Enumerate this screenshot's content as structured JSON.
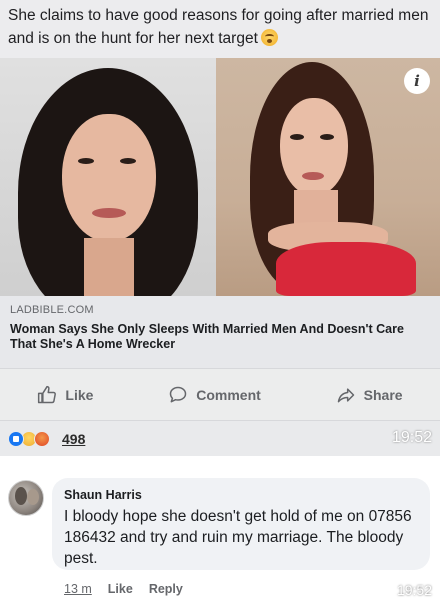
{
  "post": {
    "caption": "She claims to have good reasons for going after married men and is on the hunt for her next target",
    "caption_emoji": "flushed-face-emoji"
  },
  "link_card": {
    "info_icon": "i",
    "source": "LADBIBLE.COM",
    "title": "Woman Says She Only Sleeps With Married Men And Doesn't Care That She's A Home Wrecker"
  },
  "actions": {
    "like_label": "Like",
    "comment_label": "Comment",
    "share_label": "Share"
  },
  "reactions": {
    "icons": [
      "like-reaction-icon",
      "haha-reaction-icon",
      "angry-reaction-icon"
    ],
    "count": "498",
    "time": "19:52"
  },
  "comment": {
    "author": "Shaun Harris",
    "text": "I bloody hope she doesn't get hold of me on 07856 186432 and try and ruin my marriage. The bloody pest.",
    "age": "13 m",
    "like_label": "Like",
    "reply_label": "Reply",
    "time": "19:52"
  },
  "colors": {
    "accent": "#1877f2",
    "muted_text": "#65676b",
    "bubble": "#f0f2f5"
  }
}
